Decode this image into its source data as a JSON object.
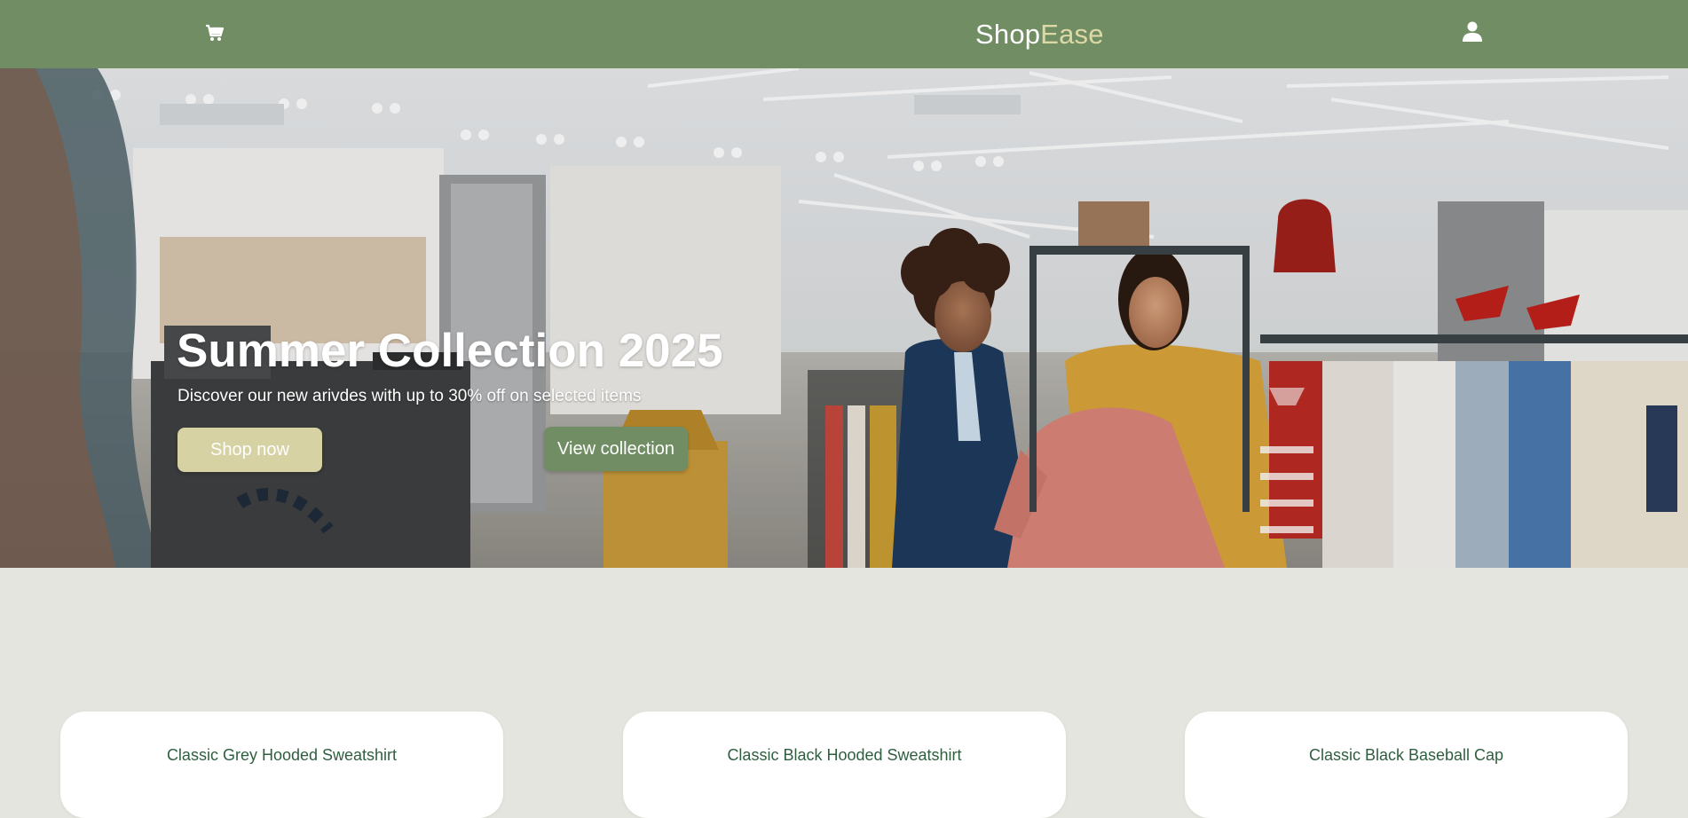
{
  "header": {
    "logo_primary": "Shop",
    "logo_accent": "Ease",
    "cart_icon": "cart-icon",
    "user_icon": "user-icon"
  },
  "hero": {
    "title": "Summer Collection 2025",
    "subtitle": "Discover our new arivdes with up to 30% off on selected items",
    "shop_button": "Shop now",
    "view_button": "View collection"
  },
  "products": [
    {
      "name": "Classic Grey Hooded Sweatshirt"
    },
    {
      "name": "Classic Black Hooded Sweatshirt"
    },
    {
      "name": "Classic Black Baseball Cap"
    }
  ],
  "colors": {
    "header_bg": "#708d64",
    "logo_accent": "#ddd8a6",
    "shop_button_bg": "#d6d2a3",
    "view_button_bg": "#708d64",
    "page_bg": "#e5e5df",
    "product_title": "#2f5e3f"
  }
}
